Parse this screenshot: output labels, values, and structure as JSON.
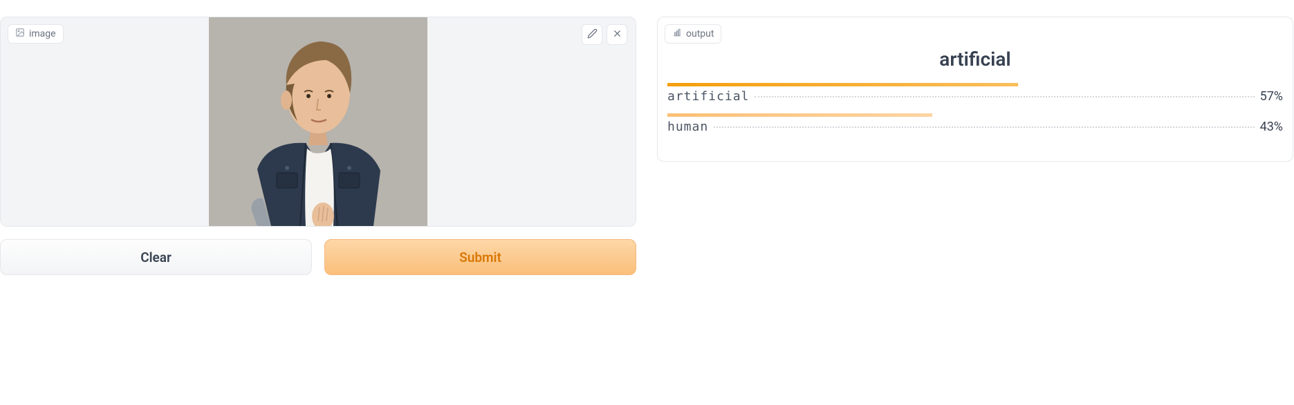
{
  "image_panel": {
    "label": "image"
  },
  "buttons": {
    "clear": "Clear",
    "submit": "Submit"
  },
  "output": {
    "label": "output",
    "top_prediction": "artificial",
    "results": [
      {
        "label": "artificial",
        "percent": 57,
        "percent_text": "57%",
        "color": "#f59e0b"
      },
      {
        "label": "human",
        "percent": 43,
        "percent_text": "43%",
        "color": "#fbbf74"
      }
    ]
  }
}
